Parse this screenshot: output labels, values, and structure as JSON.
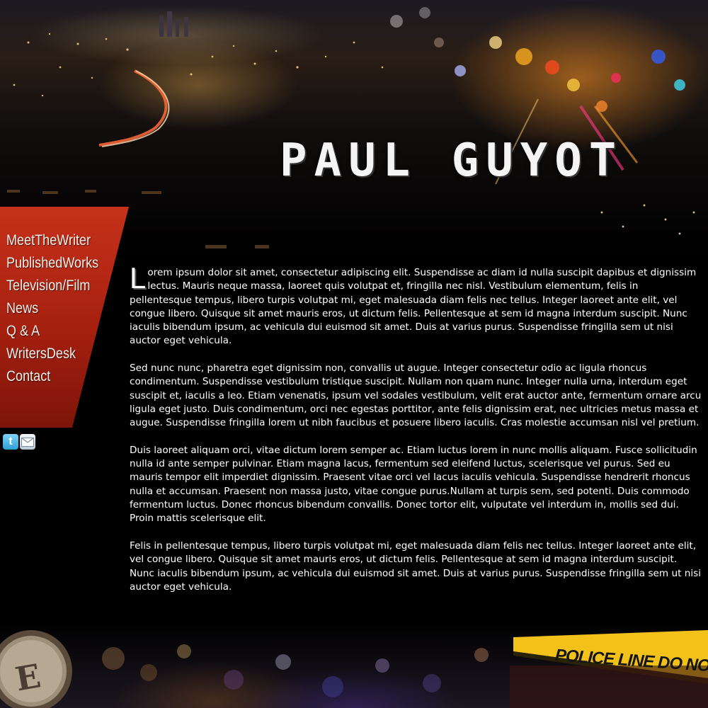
{
  "header": {
    "title": "PAUL GUYOT"
  },
  "nav": {
    "items": [
      {
        "label": "MeetTheWriter"
      },
      {
        "label": "PublishedWorks"
      },
      {
        "label": "Television/Film"
      },
      {
        "label": "News"
      },
      {
        "label": "Q & A"
      },
      {
        "label": "WritersDesk"
      },
      {
        "label": "Contact"
      }
    ]
  },
  "social": {
    "icons": [
      "twitter-icon",
      "mail-icon"
    ]
  },
  "content": {
    "dropcap": "L",
    "paragraph_1": "orem ipsum dolor sit amet, consectetur adipiscing elit. Suspendisse ac diam id nulla suscipit dapibus et dignissim lectus. Mauris neque massa, laoreet quis volutpat et, fringilla nec nisl. Vestibulum elementum, felis in pellentesque tempus, libero turpis volutpat mi, eget malesuada diam felis nec tellus. Integer laoreet ante elit, vel congue libero. Quisque sit amet mauris eros, ut dictum felis. Pellentesque at sem id magna interdum suscipit. Nunc iaculis bibendum ipsum, ac vehicula dui euismod sit amet. Duis at varius purus. Suspendisse fringilla sem ut nisi auctor eget vehicula.",
    "paragraph_2": "Sed nunc nunc, pharetra eget dignissim non, convallis ut augue. Integer consectetur odio ac ligula rhoncus condimentum. Suspendisse vestibulum tristique suscipit. Nullam non quam nunc. Integer nulla urna, interdum eget suscipit et, iaculis a leo. Etiam venenatis, ipsum vel sodales vestibulum, velit erat auctor ante, fermentum ornare arcu ligula eget justo. Duis condimentum, orci nec egestas porttitor, ante felis dignissim erat, nec ultricies metus massa et augue. Suspendisse fringilla lorem ut nibh faucibus et posuere libero iaculis. Cras molestie accumsan nisl vel pretium.",
    "paragraph_3": "Duis laoreet aliquam orci, vitae dictum lorem semper ac. Etiam luctus lorem in nunc mollis aliquam. Fusce sollicitudin nulla id ante semper pulvinar. Etiam magna lacus, fermentum sed eleifend luctus, scelerisque vel purus. Sed eu mauris tempor elit imperdiet dignissim. Praesent vitae orci vel lacus iaculis vehicula. Suspendisse hendrerit rhoncus nulla et accumsan. Praesent non massa justo, vitae congue purus.Nullam at turpis sem, sed potenti. Duis commodo fermentum luctus. Donec rhoncus bibendum convallis. Donec tortor elit, vulputate vel interdum in, mollis sed dui. Proin mattis scelerisque elit.",
    "paragraph_4": "Felis in pellentesque tempus, libero turpis volutpat mi, eget malesuada diam felis nec tellus. Integer laoreet ante elit, vel congue libero. Quisque sit amet mauris eros, ut dictum felis. Pellentesque at sem id magna interdum suscipit. Nunc iaculis bibendum ipsum, ac vehicula dui euismod sit amet. Duis at varius purus. Suspendisse fringilla sem ut nisi auctor eget vehicula."
  },
  "footer": {
    "typewriter_key": "E",
    "tape_text": "POLICE LINE DO NOT CROSS"
  },
  "colors": {
    "nav_red": "#b3250f",
    "background": "#000000",
    "text": "#ffffff",
    "tape_yellow": "#f2c21a"
  }
}
